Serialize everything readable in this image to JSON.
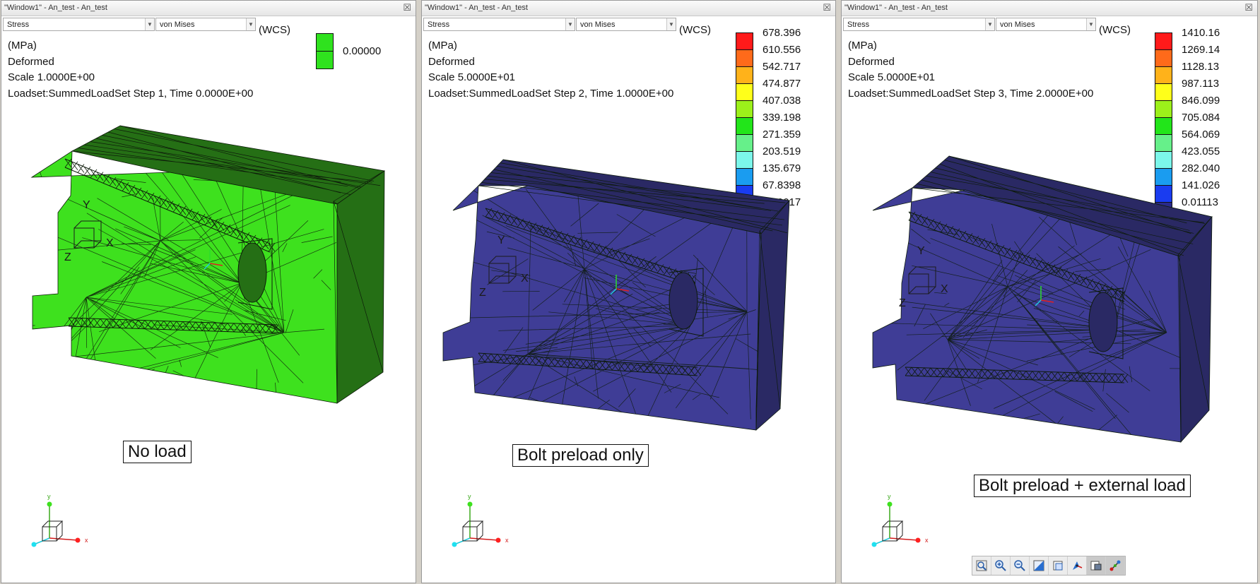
{
  "colors": {
    "mesh_green": "#3ee11e",
    "mesh_green_dark": "#256f15",
    "mesh_blue": "#3f3d96",
    "mesh_blue_dark": "#2a2964",
    "mesh_edge": "#0d1a0a"
  },
  "window1": {
    "title": "\"Window1\" - An_test - An_test",
    "quantity": "Stress",
    "component": "von Mises",
    "wcs": "(WCS)",
    "units": "(MPa)",
    "display": "Deformed",
    "scale": "Scale  1.0000E+00",
    "loadset": "Loadset:SummedLoadSet Step 1, Time  0.0000E+00",
    "legend": [
      "0.00000"
    ],
    "legend_colors": [
      "#2fe21e",
      "#2fe21e"
    ],
    "caption": "No load"
  },
  "window2": {
    "title": "\"Window1\" - An_test - An_test",
    "quantity": "Stress",
    "component": "von Mises",
    "wcs": "(WCS)",
    "units": "(MPa)",
    "display": "Deformed",
    "scale": "Scale  5.0000E+01",
    "loadset": "Loadset:SummedLoadSet Step 2, Time  1.0000E+00",
    "legend": [
      "678.396",
      "610.556",
      "542.717",
      "474.877",
      "407.038",
      "339.198",
      "271.359",
      "203.519",
      "135.679",
      "67.8398",
      "0.00017"
    ],
    "legend_colors": [
      "#ff1a1a",
      "#ff6a1a",
      "#ffb21a",
      "#ffff1a",
      "#9cf01a",
      "#22e51a",
      "#66f08a",
      "#7cf7ea",
      "#1a9cf0",
      "#1a3cf0",
      "#2a2a8a"
    ],
    "caption": "Bolt preload only"
  },
  "window3": {
    "title": "\"Window1\" - An_test - An_test",
    "quantity": "Stress",
    "component": "von Mises",
    "wcs": "(WCS)",
    "units": "(MPa)",
    "display": "Deformed",
    "scale": "Scale  5.0000E+01",
    "loadset": "Loadset:SummedLoadSet Step 3, Time  2.0000E+00",
    "legend": [
      "1410.16",
      "1269.14",
      "1128.13",
      "987.113",
      "846.099",
      "705.084",
      "564.069",
      "423.055",
      "282.040",
      "141.026",
      "0.01113"
    ],
    "legend_colors": [
      "#ff1a1a",
      "#ff6a1a",
      "#ffb21a",
      "#ffff1a",
      "#9cf01a",
      "#22e51a",
      "#66f08a",
      "#7cf7ea",
      "#1a9cf0",
      "#1a3cf0",
      "#2a2a8a"
    ],
    "caption": "Bolt preload + external load"
  },
  "triad_labels": {
    "x": "x",
    "y": "y"
  },
  "bottom_toolbar": [
    "zoom-fit-icon",
    "zoom-in-icon",
    "zoom-out-icon",
    "shade-icon",
    "saved-views-icon",
    "spin-center-icon",
    "display-style-icon",
    "datum-display-icon"
  ]
}
